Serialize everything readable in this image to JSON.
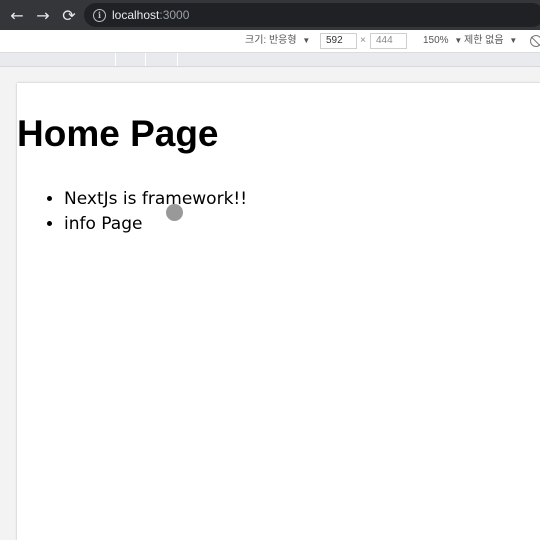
{
  "browser": {
    "url_host": "localhost",
    "url_port": ":3000"
  },
  "devtools": {
    "size_label": "크기: 반응형",
    "width": "592",
    "height": "444",
    "times": "×",
    "zoom": "150%",
    "throttle": "제한 없음",
    "dropdown_arrow": "▼"
  },
  "page": {
    "title": "Home Page",
    "links": [
      "NextJs is framework!!",
      "info Page"
    ]
  }
}
